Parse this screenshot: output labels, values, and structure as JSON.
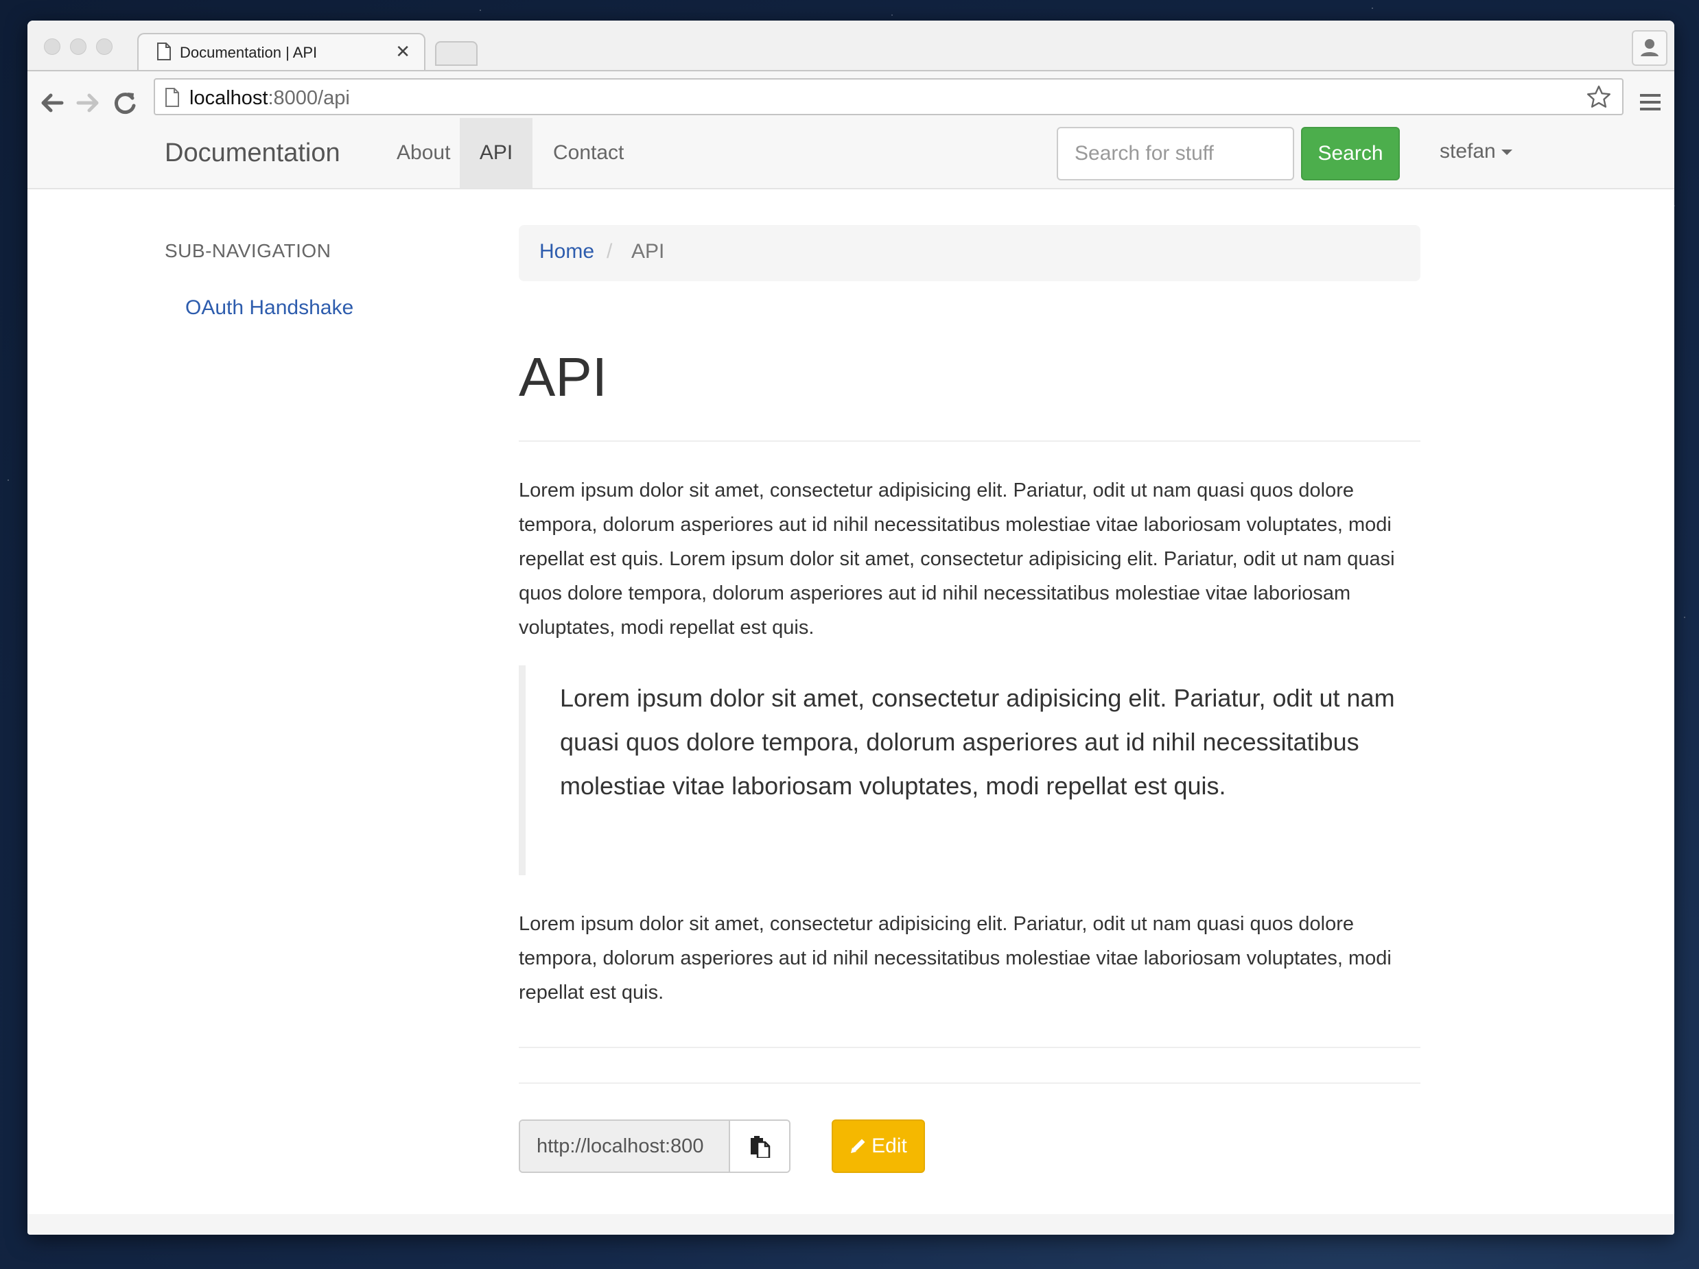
{
  "browser": {
    "tab_title": "Documentation | API",
    "url_host": "localhost",
    "url_path": ":8000/api"
  },
  "navbar": {
    "brand": "Documentation",
    "links": [
      "About",
      "API",
      "Contact"
    ],
    "active": "API",
    "search_placeholder": "Search for stuff",
    "search_button": "Search",
    "user": "stefan"
  },
  "sidebar": {
    "heading": "SUB-NAVIGATION",
    "items": [
      "OAuth Handshake"
    ]
  },
  "breadcrumb": {
    "home": "Home",
    "separator": "/",
    "current": "API"
  },
  "content": {
    "title": "API",
    "paragraph1": "Lorem ipsum dolor sit amet, consectetur adipisicing elit. Pariatur, odit ut nam quasi quos dolore tempora, dolorum asperiores aut id nihil necessitatibus molestiae vitae laboriosam voluptates, modi repellat est quis. Lorem ipsum dolor sit amet, consectetur adipisicing elit. Pariatur, odit ut nam quasi quos dolore tempora, dolorum asperiores aut id nihil necessitatibus molestiae vitae laboriosam voluptates, modi repellat est quis.",
    "blockquote": "Lorem ipsum dolor sit amet, consectetur adipisicing elit. Pariatur, odit ut nam quasi quos dolore tempora, dolorum asperiores aut id nihil necessitatibus molestiae vitae laboriosam voluptates, modi repellat est quis.",
    "paragraph2": "Lorem ipsum dolor sit amet, consectetur adipisicing elit. Pariatur, odit ut nam quasi quos dolore tempora, dolorum asperiores aut id nihil necessitatibus molestiae vitae laboriosam voluptates, modi repellat est quis."
  },
  "footer_actions": {
    "url_value": "http://localhost:800",
    "edit_label": "Edit"
  },
  "colors": {
    "link": "#2d5cad",
    "success": "#4cae4c",
    "warning": "#f5b800"
  },
  "icons": [
    "document-icon",
    "close-icon",
    "back-arrow-icon",
    "forward-arrow-icon",
    "reload-icon",
    "page-icon",
    "star-icon",
    "menu-icon",
    "profile-icon",
    "caret-down-icon",
    "clipboard-icon",
    "pencil-icon"
  ]
}
